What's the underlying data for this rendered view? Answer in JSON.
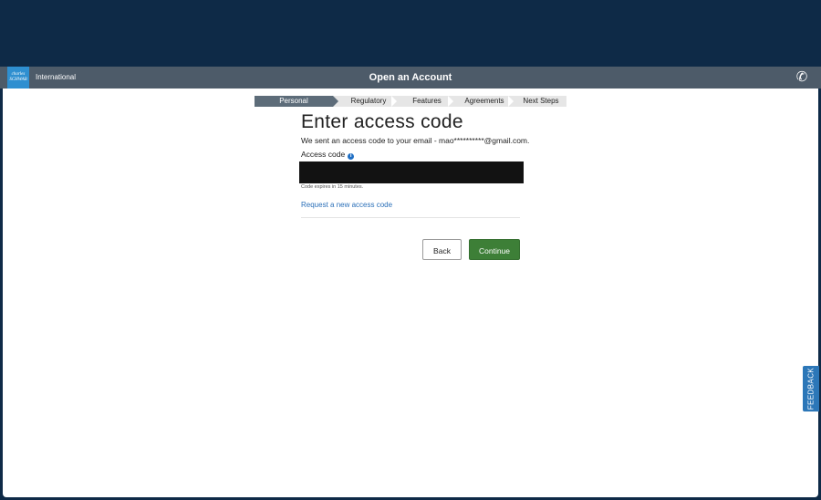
{
  "header": {
    "logo_text": [
      "charles",
      "SCHWAB"
    ],
    "region_label": "International",
    "title": "Open an Account",
    "phone_icon": "phone-icon"
  },
  "progress": {
    "steps": [
      {
        "label": "Personal",
        "active": true
      },
      {
        "label": "Regulatory",
        "active": false
      },
      {
        "label": "Features",
        "active": false
      },
      {
        "label": "Agreements",
        "active": false
      },
      {
        "label": "Next Steps",
        "active": false
      }
    ]
  },
  "form": {
    "heading": "Enter access code",
    "sent_message": "We sent an access code to your email - mao**********@gmail.com.",
    "access_code_label": "Access code",
    "info_icon": "info-icon",
    "access_code_value": "",
    "expires_note": "Code expires in 15 minutes.",
    "request_link": "Request a new access code"
  },
  "actions": {
    "back_label": "Back",
    "continue_label": "Continue"
  },
  "feedback_tab": {
    "label": "FEEDBACK"
  },
  "colors": {
    "page_bg": "#0e2a47",
    "header_bg": "#4d5b69",
    "active_step": "#5d6c79",
    "link": "#2a6fb8",
    "continue_button": "#3d7f37",
    "feedback_tab": "#2c77b8"
  }
}
